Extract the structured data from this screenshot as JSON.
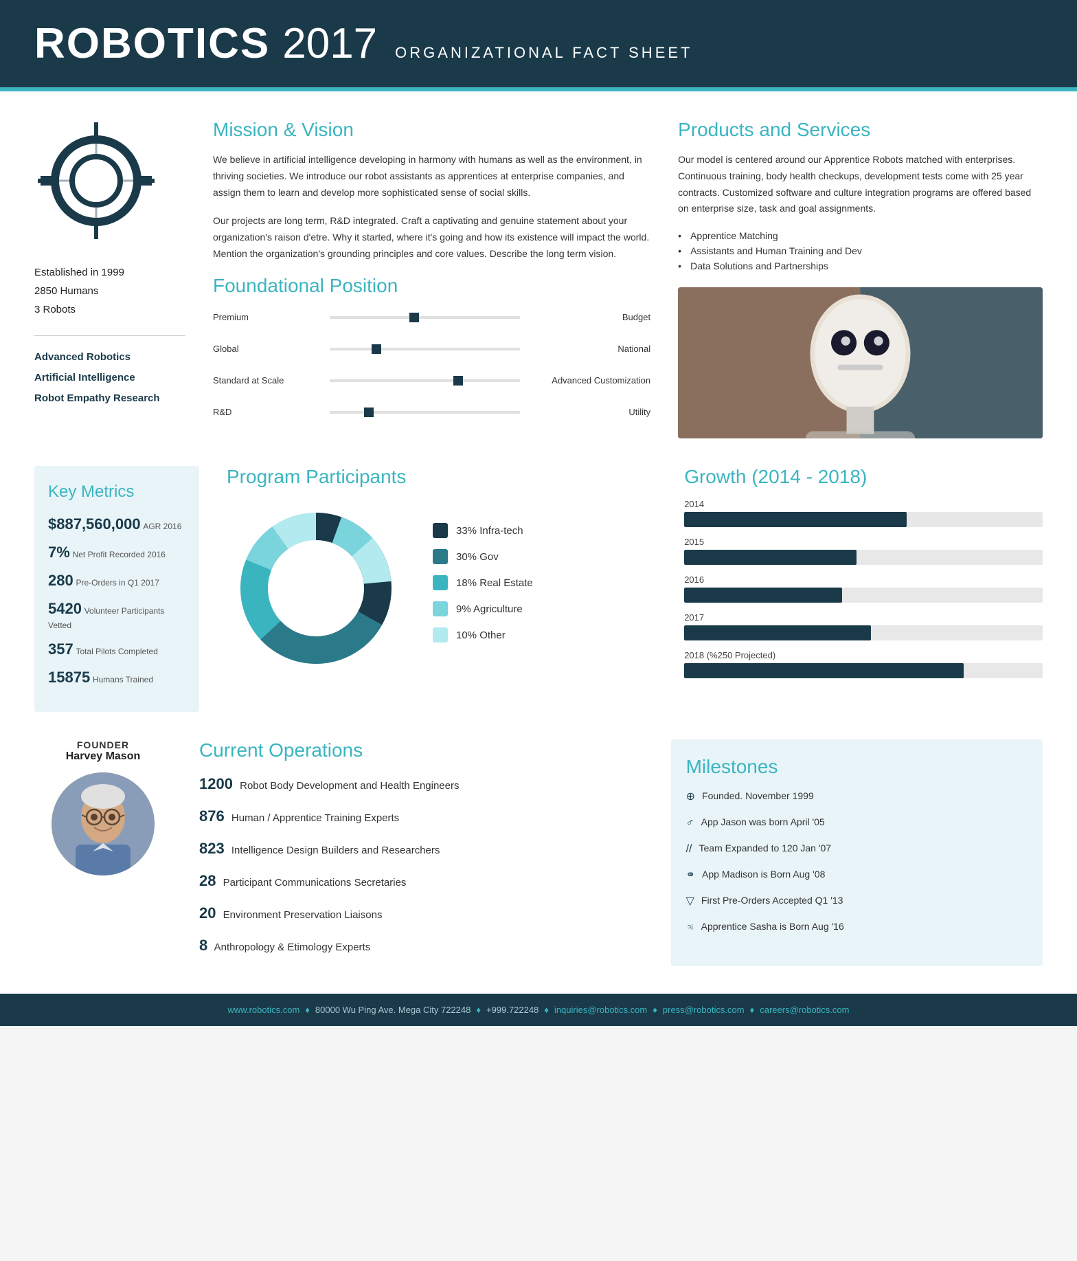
{
  "header": {
    "brand": "ROBOTICS",
    "year": "2017",
    "subtitle": "ORGANIZATIONAL FACT SHEET"
  },
  "left_col": {
    "established": "Established in 1999",
    "humans": "2850 Humans",
    "robots": "3 Robots",
    "specialties": [
      "Advanced Robotics",
      "Artificial Intelligence",
      "Robot Empathy Research"
    ]
  },
  "mission": {
    "heading": "Mission & Vision",
    "para1": "We believe in artificial intelligence developing in harmony with humans as well as the environment, in thriving societies. We introduce our robot assistants as apprentices at enterprise companies, and assign them to learn and develop more sophisticated sense of social skills.",
    "para2": "Our projects are long term, R&D integrated. Craft a captivating and genuine statement about your organization's raison d'etre. Why it started, where it's going and how its existence will impact the world. Mention the organization's grounding principles and core values. Describe the long term vision."
  },
  "foundational": {
    "heading": "Foundational Position",
    "rows": [
      {
        "left": "Premium",
        "right": "Budget",
        "position": 42
      },
      {
        "left": "Global",
        "right": "National",
        "position": 28
      },
      {
        "left": "Standard at Scale",
        "right": "Advanced Customization",
        "position": 65
      },
      {
        "left": "R&D",
        "right": "Utility",
        "position": 20
      }
    ]
  },
  "products": {
    "heading": "Products and Services",
    "text": "Our model is centered around our Apprentice Robots matched with enterprises. Continuous training, body health checkups, development tests come with 25 year contracts. Customized software and culture integration programs are offered based on enterprise size, task and goal assignments.",
    "bullets": [
      "Apprentice Matching",
      "Assistants and Human Training and Dev",
      "Data Solutions and Partnerships"
    ]
  },
  "key_metrics": {
    "heading": "Key Metrics",
    "items": [
      {
        "big": "$887,560,000",
        "small": "AGR 2016"
      },
      {
        "big": "7%",
        "small": "Net Profit Recorded 2016"
      },
      {
        "big": "280",
        "small": "Pre-Orders in Q1 2017"
      },
      {
        "big": "5420",
        "small": "Volunteer Participants Vetted"
      },
      {
        "big": "357",
        "small": "Total Pilots Completed"
      },
      {
        "big": "15875",
        "small": "Humans Trained"
      }
    ]
  },
  "program_participants": {
    "heading": "Program Participants",
    "segments": [
      {
        "label": "33%  Infra-tech",
        "pct": 33,
        "color": "#1a3a4a"
      },
      {
        "label": "30%  Gov",
        "pct": 30,
        "color": "#2a7a8a"
      },
      {
        "label": "18%  Real Estate",
        "pct": 18,
        "color": "#3ab5c0"
      },
      {
        "label": "9%  Agriculture",
        "pct": 9,
        "color": "#7ad4dc"
      },
      {
        "label": "10%  Other",
        "pct": 10,
        "color": "#b2eaf0"
      }
    ]
  },
  "growth": {
    "heading": "Growth (2014 - 2018)",
    "bars": [
      {
        "year": "2014",
        "pct": 62
      },
      {
        "year": "2015",
        "pct": 48
      },
      {
        "year": "2016",
        "pct": 44
      },
      {
        "year": "2017",
        "pct": 52
      },
      {
        "year": "2018 (%250 Projected)",
        "pct": 75
      }
    ]
  },
  "founder": {
    "label": "FOUNDER",
    "name": "Harvey Mason"
  },
  "current_ops": {
    "heading": "Current Operations",
    "items": [
      {
        "num": "1200",
        "text": "Robot Body Development and Health Engineers"
      },
      {
        "num": "876",
        "text": "Human / Apprentice Training Experts"
      },
      {
        "num": "823",
        "text": "Intelligence Design Builders and Researchers"
      },
      {
        "num": "28",
        "text": "Participant Communications Secretaries"
      },
      {
        "num": "20",
        "text": "Environment Preservation Liaisons"
      },
      {
        "num": "8",
        "text": "Anthropology & Etimology Experts"
      }
    ]
  },
  "milestones": {
    "heading": "Milestones",
    "items": [
      {
        "icon": "⊕",
        "text": "Founded. November 1999"
      },
      {
        "icon": "♂",
        "text": "App Jason was born April '05"
      },
      {
        "icon": "//",
        "text": "Team Expanded to 120 Jan '07"
      },
      {
        "icon": "⚭",
        "text": "App Madison is Born Aug '08"
      },
      {
        "icon": "▽",
        "text": "First Pre-Orders Accepted Q1 '13"
      },
      {
        "icon": "♃",
        "text": "Apprentice Sasha is Born Aug '16"
      }
    ]
  },
  "footer": {
    "items": [
      "www.robotics.com",
      "80000 Wu Ping Ave. Mega City 722248",
      "+999.722248",
      "inquiries@robotics.com",
      "press@robotics.com",
      "careers@robotics.com"
    ]
  }
}
